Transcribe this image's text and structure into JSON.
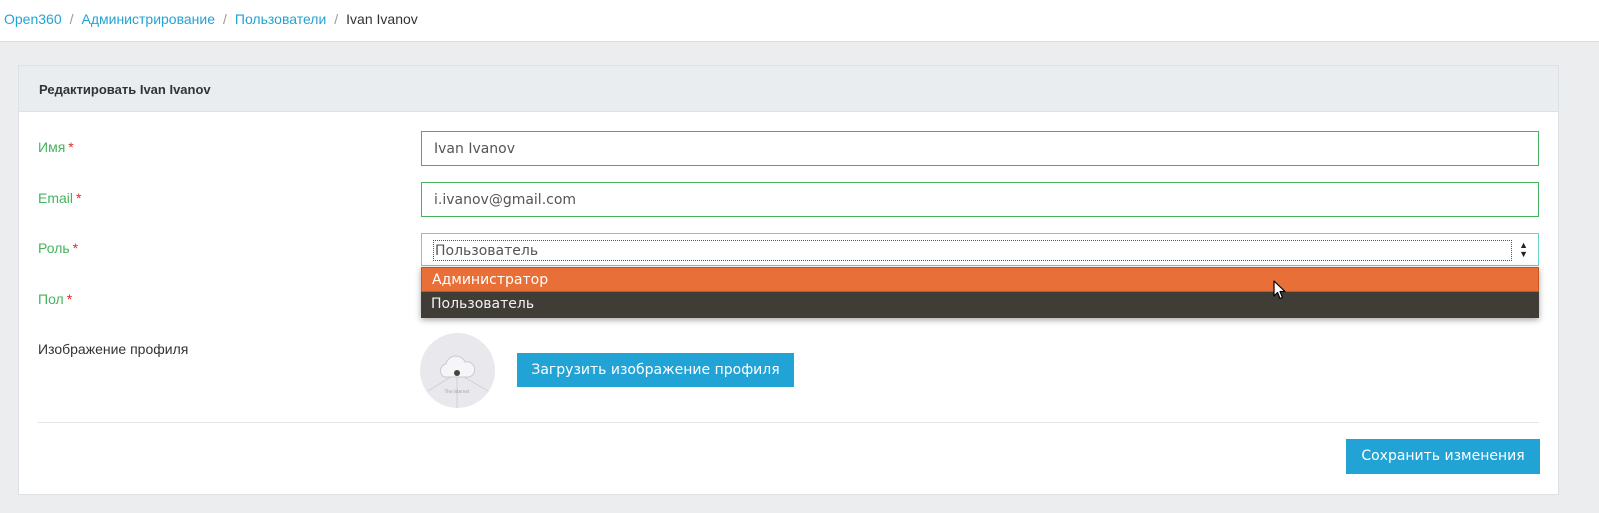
{
  "breadcrumb": {
    "items": [
      "Open360",
      "Администрирование",
      "Пользователи"
    ],
    "separator": "/",
    "current": "Ivan Ivanov"
  },
  "panel": {
    "title": "Редактировать Ivan Ivanov"
  },
  "form": {
    "name": {
      "label": "Имя",
      "required_mark": "*",
      "value": "Ivan Ivanov"
    },
    "email": {
      "label": "Email",
      "required_mark": "*",
      "value": "i.ivanov@gmail.com"
    },
    "role": {
      "label": "Роль",
      "required_mark": "*",
      "value": "Пользователь",
      "options": [
        "Администратор",
        "Пользователь"
      ],
      "highlighted_option": "Администратор"
    },
    "gender": {
      "label": "Пол",
      "required_mark": "*"
    },
    "profile_image": {
      "label": "Изображение профиля",
      "upload_label": "Загрузить изображение профиля"
    }
  },
  "actions": {
    "save_label": "Сохранить изменения"
  },
  "colors": {
    "accent": "#22a3d6",
    "valid_green": "#45b35d",
    "required_red": "#e02b2b",
    "dropdown_bg": "#3f3d36",
    "dropdown_highlight": "#e86f37"
  }
}
